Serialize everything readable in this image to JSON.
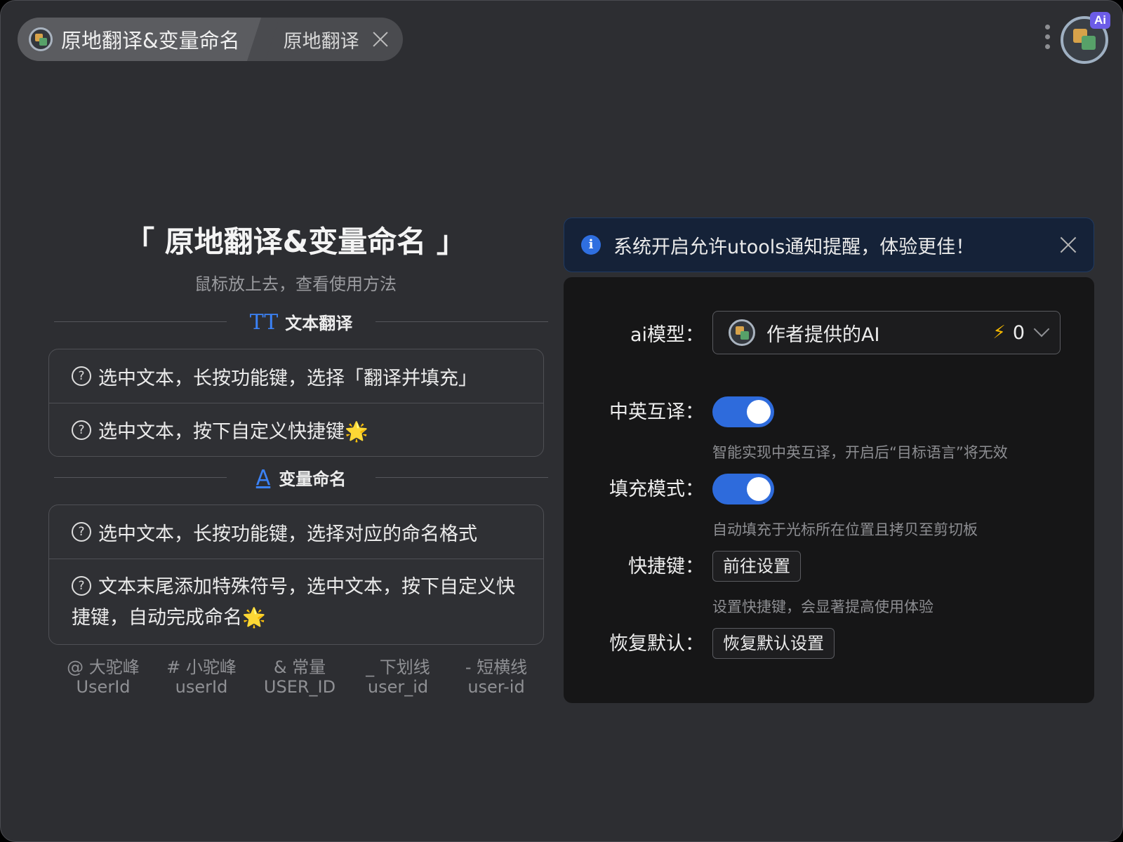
{
  "tabs": {
    "main_label": "原地翻译&变量命名",
    "sub_label": "原地翻译"
  },
  "header": {
    "ai_badge": "Ai"
  },
  "left": {
    "title": "「 原地翻译&变量命名 」",
    "subtitle": "鼠标放上去，查看使用方法",
    "section_translate": {
      "icon_glyph": "TT",
      "label": "文本翻译",
      "items": [
        "选中文本，长按功能键，选择「翻译并填充」",
        "选中文本，按下自定义快捷键🌟"
      ]
    },
    "section_naming": {
      "icon_glyph": "A",
      "label": "变量命名",
      "items": [
        "选中文本，长按功能键，选择对应的命名格式",
        "文本末尾添加特殊符号，选中文本，按下自定义快捷键，自动完成命名🌟"
      ]
    },
    "formats": [
      {
        "symbol_label": "@ 大驼峰",
        "example": "UserId"
      },
      {
        "symbol_label": "# 小驼峰",
        "example": "userId"
      },
      {
        "symbol_label": "& 常量",
        "example": "USER_ID"
      },
      {
        "symbol_label": "_ 下划线",
        "example": "user_id"
      },
      {
        "symbol_label": "- 短横线",
        "example": "user-id"
      }
    ]
  },
  "notice": {
    "icon": "i",
    "text": "系统开启允许utools通知提醒，体验更佳！"
  },
  "settings": {
    "ai_model": {
      "label": "ai模型：",
      "value": "作者提供的AI",
      "bolt_icon": "⚡",
      "count": "0"
    },
    "translate_toggle": {
      "label": "中英互译：",
      "on": true,
      "hint": "智能实现中英互译，开启后“目标语言”将无效"
    },
    "fill_toggle": {
      "label": "填充模式：",
      "on": true,
      "hint": "自动填充于光标所在位置且拷贝至剪切板"
    },
    "shortcut": {
      "label": "快捷键：",
      "button": "前往设置",
      "hint": "设置快捷键，会显著提高使用体验"
    },
    "reset": {
      "label": "恢复默认：",
      "button": "恢复默认设置"
    }
  },
  "colors": {
    "accent": "#2e6bdc",
    "window_bg": "#2d2e32",
    "panel_bg": "#161617",
    "notice_bg": "#152238",
    "star": "#f5c518"
  }
}
